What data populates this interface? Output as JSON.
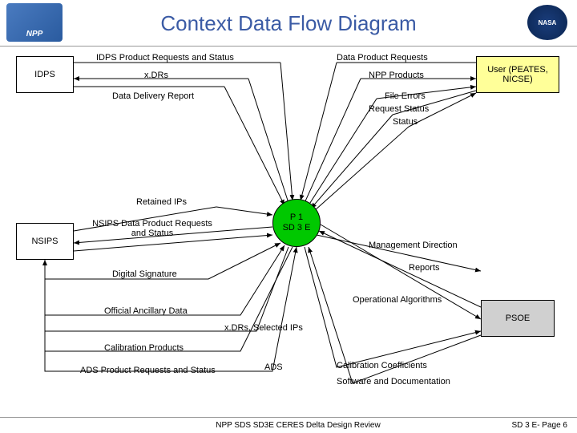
{
  "header": {
    "title": "Context Data Flow Diagram",
    "logo_left": "NPP",
    "logo_right": "NASA"
  },
  "entities": {
    "idps": "IDPS",
    "nsips": "NSIPS",
    "user": "User (PEATES, NICSE)",
    "psoe": "PSOE"
  },
  "process": {
    "line1": "P 1",
    "line2": "SD 3 E"
  },
  "flows": {
    "idps_requests": "IDPS Product Requests and Status",
    "xdrs": "x.DRs",
    "data_delivery": "Data Delivery Report",
    "data_product_requests": "Data Product Requests",
    "npp_products": "NPP Products",
    "file_errors": "File Errors",
    "request_status": "Request Status",
    "status": "Status",
    "retained_ips": "Retained IPs",
    "nsips_requests": "NSIPS Data Product Requests and Status",
    "digital_signature": "Digital Signature",
    "official_ancillary": "Official Ancillary Data",
    "xdrs_selected": "x.DRs, Selected IPs",
    "calibration_products": "Calibration Products",
    "ads_requests": "ADS Product Requests and Status",
    "ads": "ADS",
    "management_direction": "Management Direction",
    "reports": "Reports",
    "operational_algorithms": "Operational Algorithms",
    "calibration_coeffs": "Calibration Coefficients",
    "software_docs": "Software and Documentation"
  },
  "footer": {
    "center": "NPP SDS SD3E CERES Delta Design Review",
    "right": "SD 3 E- Page 6"
  }
}
